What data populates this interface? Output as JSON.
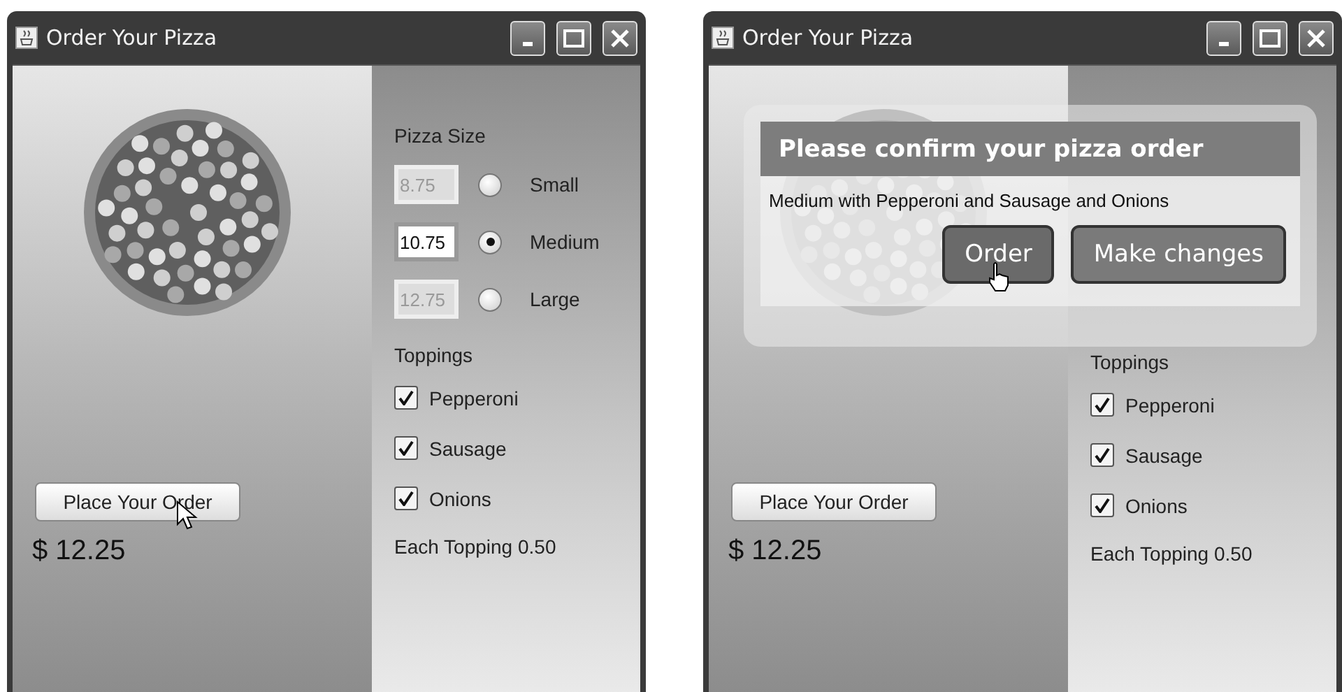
{
  "windows": [
    {
      "title": "Order Your Pizza",
      "size_label": "Pizza Size",
      "sizes": [
        {
          "price": "8.75",
          "label": "Small",
          "selected": false
        },
        {
          "price": "10.75",
          "label": "Medium",
          "selected": true
        },
        {
          "price": "12.75",
          "label": "Large",
          "selected": false
        }
      ],
      "toppings_label": "Toppings",
      "toppings": [
        {
          "label": "Pepperoni",
          "checked": true
        },
        {
          "label": "Sausage",
          "checked": true
        },
        {
          "label": "Onions",
          "checked": true
        }
      ],
      "topping_note": "Each Topping 0.50",
      "order_button": "Place Your Order",
      "total": "$ 12.25"
    },
    {
      "title": "Order Your Pizza",
      "toppings_label": "Toppings",
      "toppings": [
        {
          "label": "Pepperoni",
          "checked": true
        },
        {
          "label": "Sausage",
          "checked": true
        },
        {
          "label": "Onions",
          "checked": true
        }
      ],
      "topping_note": "Each Topping 0.50",
      "order_button": "Place Your Order",
      "total": "$ 12.25",
      "dialog": {
        "title": "Please confirm your pizza order",
        "message": "Medium with Pepperoni and Sausage and Onions",
        "buttons": [
          {
            "label": "Order",
            "hovered": true
          },
          {
            "label": "Make changes",
            "hovered": false
          }
        ]
      }
    }
  ]
}
